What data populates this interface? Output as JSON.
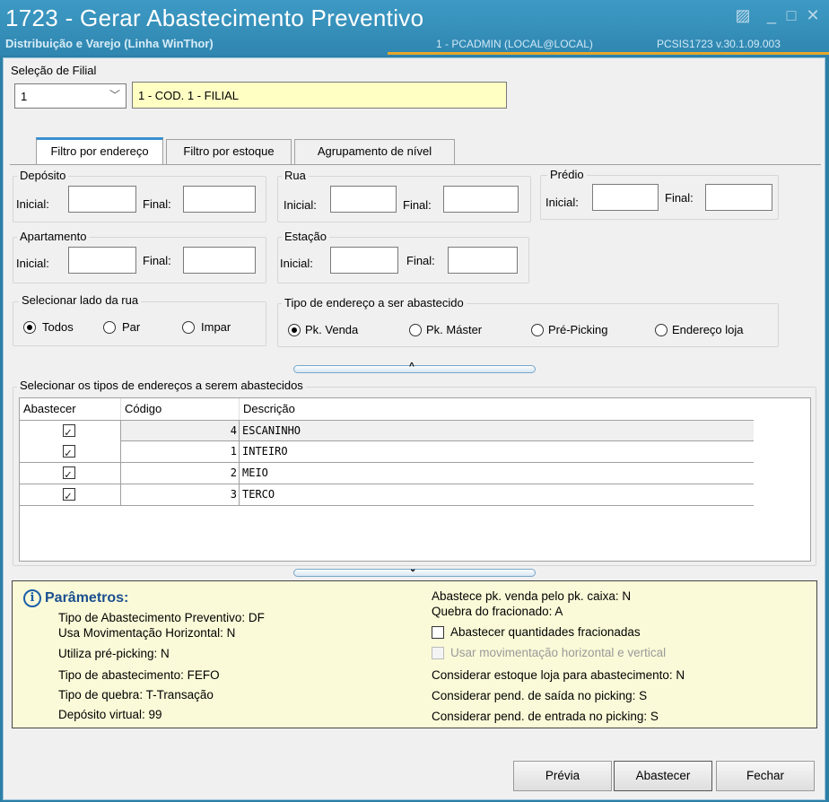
{
  "window": {
    "title": "1723 - Gerar Abastecimento Preventivo",
    "subtitle": "Distribuição e Varejo (Linha WinThor)",
    "user": "1 - PCADMIN (LOCAL@LOCAL)",
    "version": "PCSIS1723  v.30.1.09.003"
  },
  "filial": {
    "group_label": "Seleção de Filial",
    "combo_value": "1",
    "name_value": "1 - COD. 1 - FILIAL"
  },
  "tabs": [
    {
      "label": "Filtro por endereço",
      "active": true
    },
    {
      "label": "Filtro por estoque",
      "active": false
    },
    {
      "label": "Agrupamento de nível",
      "active": false
    }
  ],
  "filters": {
    "inicial_label": "Inicial:",
    "final_label": "Final:",
    "deposito": "Depósito",
    "rua": "Rua",
    "predio": "Prédio",
    "apartamento": "Apartamento",
    "estacao": "Estação"
  },
  "lado_rua": {
    "title": "Selecionar lado da rua",
    "options": [
      "Todos",
      "Par",
      "Impar"
    ],
    "selected": "Todos"
  },
  "tipo_endereco": {
    "title": "Tipo de endereço a ser abastecido",
    "options": [
      "Pk. Venda",
      "Pk. Máster",
      "Pré-Picking",
      "Endereço loja"
    ],
    "selected": "Pk. Venda"
  },
  "grid": {
    "title": "Selecionar os tipos de endereços a serem abastecidos",
    "columns": [
      "Abastecer",
      "Código",
      "Descrição"
    ],
    "rows": [
      {
        "checked": true,
        "codigo": "4",
        "descricao": "ESCANINHO"
      },
      {
        "checked": true,
        "codigo": "1",
        "descricao": "INTEIRO"
      },
      {
        "checked": true,
        "codigo": "2",
        "descricao": "MEIO"
      },
      {
        "checked": true,
        "codigo": "3",
        "descricao": "TERCO"
      }
    ]
  },
  "collapse": {
    "up_glyph": "^",
    "down_glyph": "⌄"
  },
  "params": {
    "title": "Parâmetros:",
    "left": [
      "Tipo de Abastecimento Preventivo: DF",
      "Usa Movimentação Horizontal: N",
      "Utiliza pré-picking: N",
      "Tipo de abastecimento: FEFO",
      "Tipo de quebra: T-Transação",
      "Depósito virtual: 99"
    ],
    "right_top": [
      "Abastece pk. venda pelo pk. caixa: N",
      "Quebra do fracionado: A"
    ],
    "checkbox_fracionadas": "Abastecer quantidades fracionadas",
    "checkbox_movimentacao": "Usar movimentação horizontal e vertical",
    "right_bottom": [
      "Considerar estoque loja para abastecimento: N",
      "Considerar pend. de saída no picking: S",
      "Considerar pend. de entrada no picking: S"
    ]
  },
  "buttons": {
    "previa": "Prévia",
    "abastecer": "Abastecer",
    "fechar": "Fechar"
  }
}
